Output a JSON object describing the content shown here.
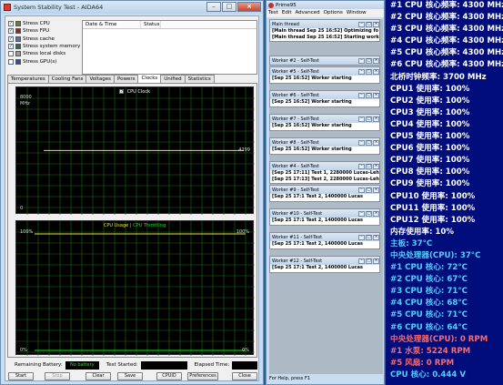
{
  "aida": {
    "title": "System Stability Test - AIDA64",
    "stress_items": [
      {
        "label": "Stress CPU",
        "checked": true,
        "icon": "cpu-chip-icon"
      },
      {
        "label": "Stress FPU",
        "checked": true,
        "icon": "fpu-chip-icon"
      },
      {
        "label": "Stress cache",
        "checked": true,
        "icon": "cache-chip-icon"
      },
      {
        "label": "Stress system memory",
        "checked": true,
        "icon": "memory-chip-icon"
      },
      {
        "label": "Stress local disks",
        "checked": false,
        "icon": "disk-icon"
      },
      {
        "label": "Stress GPU(s)",
        "checked": false,
        "icon": "gpu-chip-icon"
      }
    ],
    "log_headers": {
      "date_time": "Date & Time",
      "status": "Status"
    },
    "tabs": [
      "Temperatures",
      "Cooling Fans",
      "Voltages",
      "Powers",
      "Clocks",
      "Unified",
      "Statistics"
    ],
    "active_tab": "Clocks",
    "clock_graph": {
      "legend": "CPU Clock",
      "y_top": "8000",
      "y_unit": "MHz",
      "y_bottom": "0",
      "value_label": "4299",
      "value_fraction": 0.5374,
      "line_color": "#e8e832",
      "grid_color": "#1a6e1a"
    },
    "usage_graph": {
      "legend_usage": "CPU Usage",
      "legend_sep": "|",
      "legend_throttling": "CPU Throttling",
      "left_top": "100%",
      "right_top": "100%",
      "left_bottom": "0%",
      "right_bottom": "0%",
      "usage_color": "#e8e832",
      "throttle_color": "#21e021",
      "usage_fraction": 1.0
    },
    "status": {
      "remaining_battery_label": "Remaining Battery:",
      "battery_value": "No battery",
      "test_started_label": "Test Started:",
      "elapsed_label": "Elapsed Time:"
    },
    "buttons": {
      "start": "Start",
      "stop": "Stop",
      "clear": "Clear",
      "save": "Save",
      "cpuid": "CPUID",
      "preferences": "Preferences",
      "close": "Close"
    }
  },
  "prime": {
    "title": "Prime95",
    "menu": [
      "Test",
      "Edit",
      "Advanced",
      "Options",
      "Window"
    ],
    "windows": [
      {
        "title": "Main thread",
        "lines": [
          "[Main thread Sep 25 16:52] Optimizing fo",
          "[Main thread Sep 25 16:52] Starting work"
        ]
      },
      {
        "title": "Worker #2 - Self-Test",
        "lines": []
      },
      {
        "title": "Worker #5 - Self-Test",
        "lines": [
          "[Sep 25 16:52] Worker starting"
        ]
      },
      {
        "title": "Worker #6 - Self-Test",
        "lines": [
          "[Sep 25 16:52] Worker starting"
        ]
      },
      {
        "title": "Worker #7 - Self-Test",
        "lines": [
          "[Sep 25 16:52] Worker starting"
        ]
      },
      {
        "title": "Worker #8 - Self-Test",
        "lines": [
          "[Sep 25 16:52] Worker starting"
        ]
      },
      {
        "title": "Worker #4 - Self-Test",
        "lines": [
          "[Sep 25 17:11] Test 1, 2280000 Lucas-Leh",
          "[Sep 25 17:13] Test 2, 2280000 Lucas-Leh"
        ]
      },
      {
        "title": "Worker #9 - Self-Test",
        "lines": [
          "[Sep 25 17:1 Test 2, 1400000 Lucas"
        ]
      },
      {
        "title": "Worker #10 - Self-Test",
        "lines": [
          "[Sep 25 17:1 Test 2, 1400000 Lucas"
        ]
      },
      {
        "title": "Worker #11 - Self-Test",
        "lines": [
          "[Sep 25 17:1 Test 2, 1400000 Lucas"
        ]
      },
      {
        "title": "Worker #12 - Self-Test",
        "lines": [
          "[Sep 25 17:1 Test 2, 1400000 Lucas"
        ]
      }
    ],
    "status": "For Help, press F1"
  },
  "sensors": [
    {
      "text": "#1 CPU 核心频率: 4300 MHz",
      "color": "#ffffff"
    },
    {
      "text": "#2 CPU 核心频率: 4300 MHz",
      "color": "#ffffff"
    },
    {
      "text": "#3 CPU 核心频率: 4300 MHz",
      "color": "#ffffff"
    },
    {
      "text": "#4 CPU 核心频率: 4300 MHz",
      "color": "#ffffff"
    },
    {
      "text": "#5 CPU 核心频率: 4300 MHz",
      "color": "#ffffff"
    },
    {
      "text": "#6 CPU 核心频率: 4300 MHz",
      "color": "#ffffff"
    },
    {
      "text": "北桥时钟频率: 3700 MHz",
      "color": "#ffffff"
    },
    {
      "text": "CPU1 使用率: 100%",
      "color": "#ffffff"
    },
    {
      "text": "CPU2 使用率: 100%",
      "color": "#ffffff"
    },
    {
      "text": "CPU3 使用率: 100%",
      "color": "#ffffff"
    },
    {
      "text": "CPU4 使用率: 100%",
      "color": "#ffffff"
    },
    {
      "text": "CPU5 使用率: 100%",
      "color": "#ffffff"
    },
    {
      "text": "CPU6 使用率: 100%",
      "color": "#ffffff"
    },
    {
      "text": "CPU7 使用率: 100%",
      "color": "#ffffff"
    },
    {
      "text": "CPU8 使用率: 100%",
      "color": "#ffffff"
    },
    {
      "text": "CPU9 使用率: 100%",
      "color": "#ffffff"
    },
    {
      "text": "CPU10 使用率: 100%",
      "color": "#ffffff"
    },
    {
      "text": "CPU11 使用率: 100%",
      "color": "#ffffff"
    },
    {
      "text": "CPU12 使用率: 100%",
      "color": "#ffffff"
    },
    {
      "text": "内存使用率: 10%",
      "color": "#ffffff"
    },
    {
      "text": "主板: 37°C",
      "color": "#4fd0ff"
    },
    {
      "text": "中央处理器(CPU): 37°C",
      "color": "#4fd0ff"
    },
    {
      "text": " #1 CPU 核心: 72°C",
      "color": "#4fd0ff"
    },
    {
      "text": " #2 CPU 核心: 67°C",
      "color": "#4fd0ff"
    },
    {
      "text": " #3 CPU 核心: 71°C",
      "color": "#4fd0ff"
    },
    {
      "text": " #4 CPU 核心: 68°C",
      "color": "#4fd0ff"
    },
    {
      "text": " #5 CPU 核心: 71°C",
      "color": "#4fd0ff"
    },
    {
      "text": " #6 CPU 核心: 64°C",
      "color": "#4fd0ff"
    },
    {
      "text": "中央处理器(CPU): 0 RPM",
      "color": "#ff6a6a"
    },
    {
      "text": "#1 水泵: 5224 RPM",
      "color": "#ff6a6a"
    },
    {
      "text": "#5 风扇: 0 RPM",
      "color": "#ff6a6a"
    },
    {
      "text": "CPU 核心: 0.444 V",
      "color": "#4fd0ff"
    }
  ]
}
